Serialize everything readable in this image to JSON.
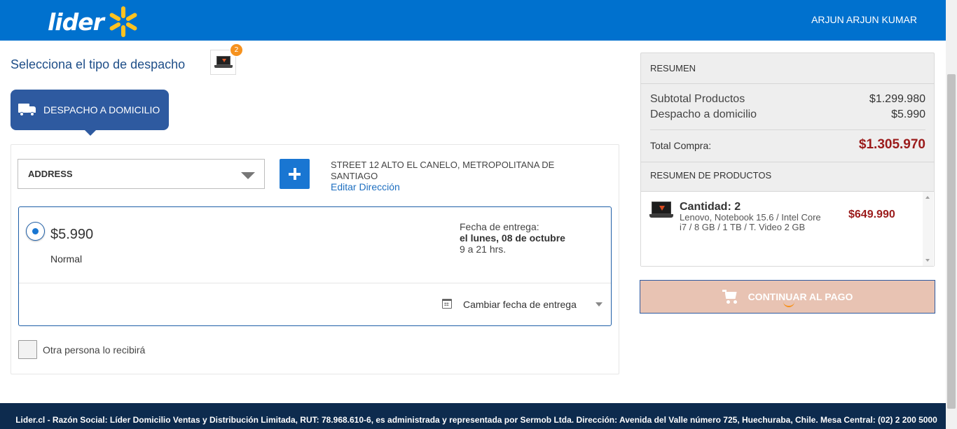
{
  "header": {
    "logo_text": "lider",
    "user_name": "ARJUN  ARJUN KUMAR",
    "brand_color": "#0071ce",
    "spark_color": "#ffc220"
  },
  "checkout": {
    "title": "Selecciona el tipo de despacho",
    "cart_badge_count": "2",
    "delivery_tab_label": "DESPACHO A DOMICILIO"
  },
  "address": {
    "select_value": "ADDRESS",
    "full_address": "STREET 12 ALTO EL CANELO, METROPOLITANA DE SANTIAGO",
    "edit_link": "Editar Dirección"
  },
  "shipping_option": {
    "price": "$5.990",
    "type": "Normal",
    "delivery_label": "Fecha de entrega:",
    "delivery_date": "el lunes, 08 de octubre",
    "delivery_hours": "9 a 21 hrs.",
    "change_date_label": "Cambiar fecha de entrega",
    "selected": true
  },
  "other_person_label": "Otra persona lo recibirá",
  "summary": {
    "title": "RESUMEN",
    "subtotal_label": "Subtotal Productos",
    "subtotal_value": "$1.299.980",
    "shipping_label": "Despacho a domicilio",
    "shipping_value": "$5.990",
    "total_label": "Total Compra:",
    "total_value": "$1.305.970",
    "products_title": "RESUMEN DE PRODUCTOS",
    "total_color": "#9b1b1b"
  },
  "products": [
    {
      "quantity": "Cantidad: 2",
      "description": "Lenovo, Notebook 15.6 / Intel Core i7 / 8 GB / 1 TB / T. Video 2 GB",
      "price": "$649.990",
      "icon": "laptop-icon"
    }
  ],
  "pay_button_label": "CONTINUAR AL PAGO",
  "footer_text": "Lider.cl - Razón Social: Líder Domicilio Ventas y Distribución Limitada, RUT: 78.968.610-6, es administrada y representada por Sermob Ltda. Dirección: Avenida del Valle número 725, Huechuraba, Chile. Mesa Central: (02) 2 200 5000"
}
